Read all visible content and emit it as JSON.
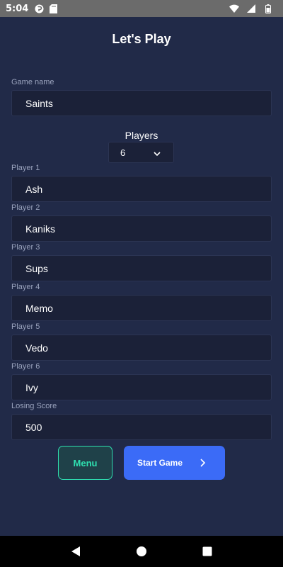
{
  "status_bar": {
    "time": "5:04",
    "icons": [
      "notification-icon",
      "sd-card-icon",
      "wifi-icon",
      "cellular-icon",
      "battery-icon"
    ]
  },
  "screen": {
    "title": "Let's Play"
  },
  "game_name": {
    "label": "Game name",
    "value": "Saints"
  },
  "players": {
    "label": "Players",
    "selected": "6"
  },
  "player_fields": [
    {
      "label": "Player 1",
      "value": "Ash"
    },
    {
      "label": "Player 2",
      "value": "Kaniks"
    },
    {
      "label": "Player 3",
      "value": "Sups"
    },
    {
      "label": "Player 4",
      "value": "Memo"
    },
    {
      "label": "Player 5",
      "value": "Vedo"
    },
    {
      "label": "Player 6",
      "value": "Ivy"
    }
  ],
  "losing_score": {
    "label": "Losing Score",
    "value": "500"
  },
  "buttons": {
    "menu": "Menu",
    "start": "Start Game"
  },
  "colors": {
    "background": "#212a48",
    "field": "#1b2138",
    "accent_teal": "#2fe0b0",
    "accent_blue": "#3b6bf7"
  }
}
